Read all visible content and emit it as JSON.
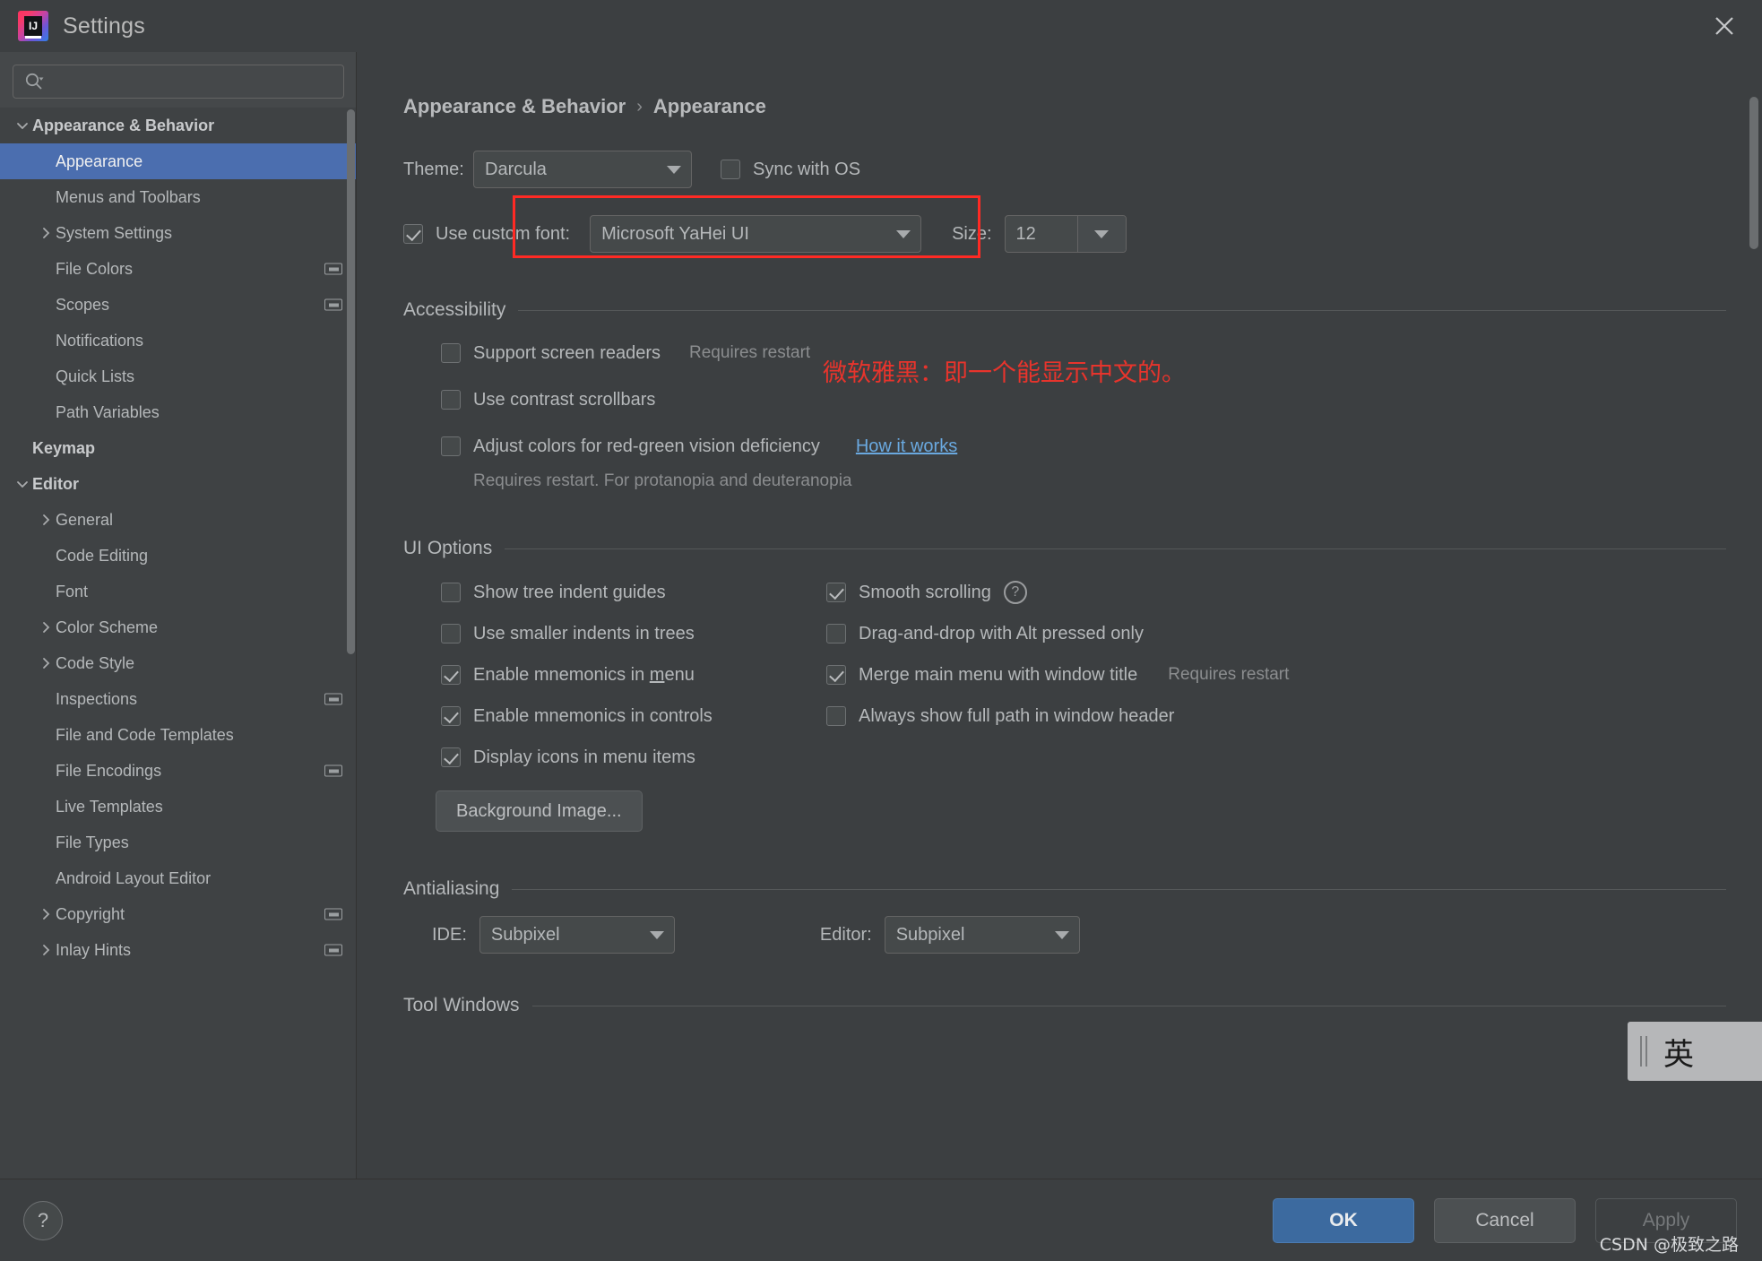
{
  "window": {
    "title": "Settings",
    "logo_icon": "intellij-idea-logo",
    "close_icon": "close-icon"
  },
  "sidebar": {
    "search": {
      "placeholder": "",
      "value": "",
      "icon": "search-icon"
    },
    "items": [
      {
        "label": "Appearance & Behavior",
        "indent": 0,
        "twisty": "chevron-down",
        "bold": true,
        "selected": false,
        "badge": false
      },
      {
        "label": "Appearance",
        "indent": 1,
        "twisty": "none",
        "bold": false,
        "selected": true,
        "badge": false
      },
      {
        "label": "Menus and Toolbars",
        "indent": 1,
        "twisty": "none",
        "bold": false,
        "selected": false,
        "badge": false
      },
      {
        "label": "System Settings",
        "indent": 1,
        "twisty": "chevron-right",
        "bold": false,
        "selected": false,
        "badge": false
      },
      {
        "label": "File Colors",
        "indent": 1,
        "twisty": "none",
        "bold": false,
        "selected": false,
        "badge": true
      },
      {
        "label": "Scopes",
        "indent": 1,
        "twisty": "none",
        "bold": false,
        "selected": false,
        "badge": true
      },
      {
        "label": "Notifications",
        "indent": 1,
        "twisty": "none",
        "bold": false,
        "selected": false,
        "badge": false
      },
      {
        "label": "Quick Lists",
        "indent": 1,
        "twisty": "none",
        "bold": false,
        "selected": false,
        "badge": false
      },
      {
        "label": "Path Variables",
        "indent": 1,
        "twisty": "none",
        "bold": false,
        "selected": false,
        "badge": false
      },
      {
        "label": "Keymap",
        "indent": 0,
        "twisty": "none",
        "bold": true,
        "selected": false,
        "badge": false
      },
      {
        "label": "Editor",
        "indent": 0,
        "twisty": "chevron-down",
        "bold": true,
        "selected": false,
        "badge": false
      },
      {
        "label": "General",
        "indent": 1,
        "twisty": "chevron-right",
        "bold": false,
        "selected": false,
        "badge": false
      },
      {
        "label": "Code Editing",
        "indent": 1,
        "twisty": "none",
        "bold": false,
        "selected": false,
        "badge": false
      },
      {
        "label": "Font",
        "indent": 1,
        "twisty": "none",
        "bold": false,
        "selected": false,
        "badge": false
      },
      {
        "label": "Color Scheme",
        "indent": 1,
        "twisty": "chevron-right",
        "bold": false,
        "selected": false,
        "badge": false
      },
      {
        "label": "Code Style",
        "indent": 1,
        "twisty": "chevron-right",
        "bold": false,
        "selected": false,
        "badge": false
      },
      {
        "label": "Inspections",
        "indent": 1,
        "twisty": "none",
        "bold": false,
        "selected": false,
        "badge": true
      },
      {
        "label": "File and Code Templates",
        "indent": 1,
        "twisty": "none",
        "bold": false,
        "selected": false,
        "badge": false
      },
      {
        "label": "File Encodings",
        "indent": 1,
        "twisty": "none",
        "bold": false,
        "selected": false,
        "badge": true
      },
      {
        "label": "Live Templates",
        "indent": 1,
        "twisty": "none",
        "bold": false,
        "selected": false,
        "badge": false
      },
      {
        "label": "File Types",
        "indent": 1,
        "twisty": "none",
        "bold": false,
        "selected": false,
        "badge": false
      },
      {
        "label": "Android Layout Editor",
        "indent": 1,
        "twisty": "none",
        "bold": false,
        "selected": false,
        "badge": false
      },
      {
        "label": "Copyright",
        "indent": 1,
        "twisty": "chevron-right",
        "bold": false,
        "selected": false,
        "badge": true
      },
      {
        "label": "Inlay Hints",
        "indent": 1,
        "twisty": "chevron-right",
        "bold": false,
        "selected": false,
        "badge": true
      }
    ]
  },
  "main": {
    "breadcrumb": {
      "root": "Appearance & Behavior",
      "separator": "›",
      "leaf": "Appearance"
    },
    "theme": {
      "label": "Theme:",
      "value": "Darcula",
      "sync_label": "Sync with OS",
      "sync_checked": false
    },
    "custom_font": {
      "label": "Use custom font:",
      "checked": true,
      "value": "Microsoft YaHei UI",
      "size_label": "Size:",
      "size_value": "12"
    },
    "annotation": {
      "text": "微软雅黑：即一个能显示中文的。",
      "color": "#e8342c"
    },
    "accessibility": {
      "title": "Accessibility",
      "items": [
        {
          "label": "Support screen readers",
          "checked": false,
          "hint": "Requires restart",
          "link": ""
        },
        {
          "label": "Use contrast scrollbars",
          "checked": false,
          "hint": "",
          "link": ""
        },
        {
          "label": "Adjust colors for red-green vision deficiency",
          "checked": false,
          "hint": "",
          "link": "How it works"
        }
      ],
      "sub_hint": "Requires restart. For protanopia and deuteranopia"
    },
    "ui_options": {
      "title": "UI Options",
      "left": [
        {
          "label": "Show tree indent guides",
          "checked": false
        },
        {
          "label": "Use smaller indents in trees",
          "checked": false
        },
        {
          "label": "Enable mnemonics in menu",
          "checked": true,
          "mnemonic": "m"
        },
        {
          "label": "Enable mnemonics in controls",
          "checked": true
        },
        {
          "label": "Display icons in menu items",
          "checked": true
        }
      ],
      "right": [
        {
          "label": "Smooth scrolling",
          "checked": true,
          "help": true,
          "hint": ""
        },
        {
          "label": "Drag-and-drop with Alt pressed only",
          "checked": false,
          "help": false,
          "hint": ""
        },
        {
          "label": "Merge main menu with window title",
          "checked": true,
          "help": false,
          "hint": "Requires restart"
        },
        {
          "label": "Always show full path in window header",
          "checked": false,
          "help": false,
          "hint": ""
        }
      ],
      "background_button": "Background Image..."
    },
    "antialiasing": {
      "title": "Antialiasing",
      "ide_label": "IDE:",
      "ide_value": "Subpixel",
      "editor_label": "Editor:",
      "editor_value": "Subpixel"
    },
    "tool_windows": {
      "title": "Tool Windows"
    }
  },
  "footer": {
    "help_icon": "help-icon",
    "ok": "OK",
    "cancel": "Cancel",
    "apply": "Apply",
    "watermark": "CSDN @极致之路"
  },
  "ime": {
    "char": "英"
  }
}
